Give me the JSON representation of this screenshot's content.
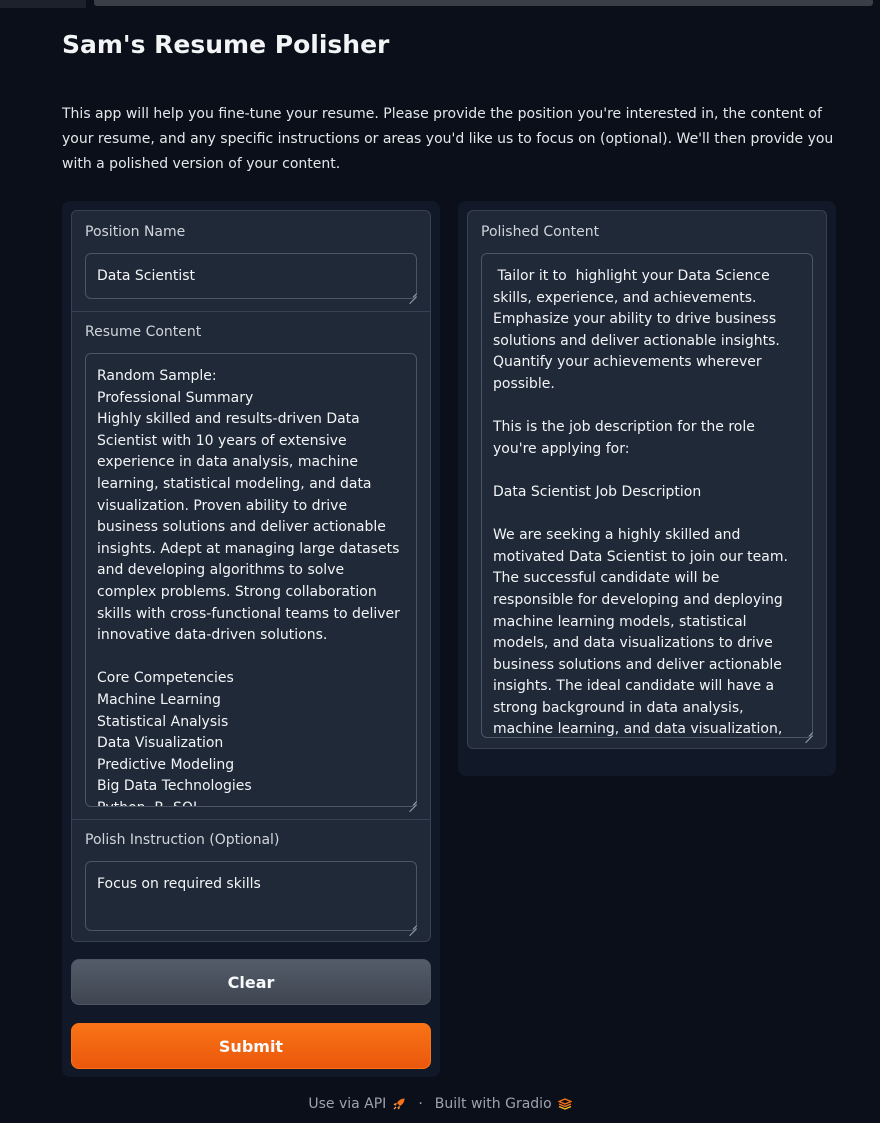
{
  "app": {
    "title": "Sam's Resume Polisher",
    "description": "This app will help you fine-tune your resume. Please provide the position you're interested in, the content of your resume, and any specific instructions or areas you'd like us to focus on (optional). We'll then provide you with a polished version of your content."
  },
  "inputs": {
    "position": {
      "label": "Position Name",
      "value": "Data Scientist"
    },
    "resume": {
      "label": "Resume Content",
      "value": "Random Sample:\nProfessional Summary\nHighly skilled and results-driven Data Scientist with 10 years of extensive experience in data analysis, machine learning, statistical modeling, and data visualization. Proven ability to drive business solutions and deliver actionable insights. Adept at managing large datasets and developing algorithms to solve complex problems. Strong collaboration skills with cross-functional teams to deliver innovative data-driven solutions.\n\nCore Competencies\nMachine Learning\nStatistical Analysis\nData Visualization\nPredictive Modeling\nBig Data Technologies\nPython, R, SQL\nData Mining"
    },
    "instruction": {
      "label": "Polish Instruction (Optional)",
      "value": "Focus on required skills"
    }
  },
  "buttons": {
    "clear": "Clear",
    "submit": "Submit"
  },
  "output": {
    "label": "Polished Content",
    "value": " Tailor it to  highlight your Data Science skills, experience, and achievements. Emphasize your ability to drive business solutions and deliver actionable insights. Quantify your achievements wherever possible.\n\nThis is the job description for the role you're applying for:\n\nData Scientist Job Description\n\nWe are seeking a highly skilled and motivated Data Scientist to join our team. The successful candidate will be responsible for developing and deploying machine learning models, statistical models, and data visualizations to drive business solutions and deliver actionable insights. The ideal candidate will have a strong background in data analysis, machine learning, and data visualization, with a proven track record of delivering business impact."
  },
  "footer": {
    "api_label": "Use via API",
    "separator": "·",
    "built_label": "Built with Gradio"
  },
  "colors": {
    "background": "#0b0f19",
    "accent": "#f97316",
    "panel": "#111827",
    "block": "#1f2937"
  },
  "icons": {
    "api": "rocket-icon",
    "gradio": "gradio-logo-icon"
  }
}
